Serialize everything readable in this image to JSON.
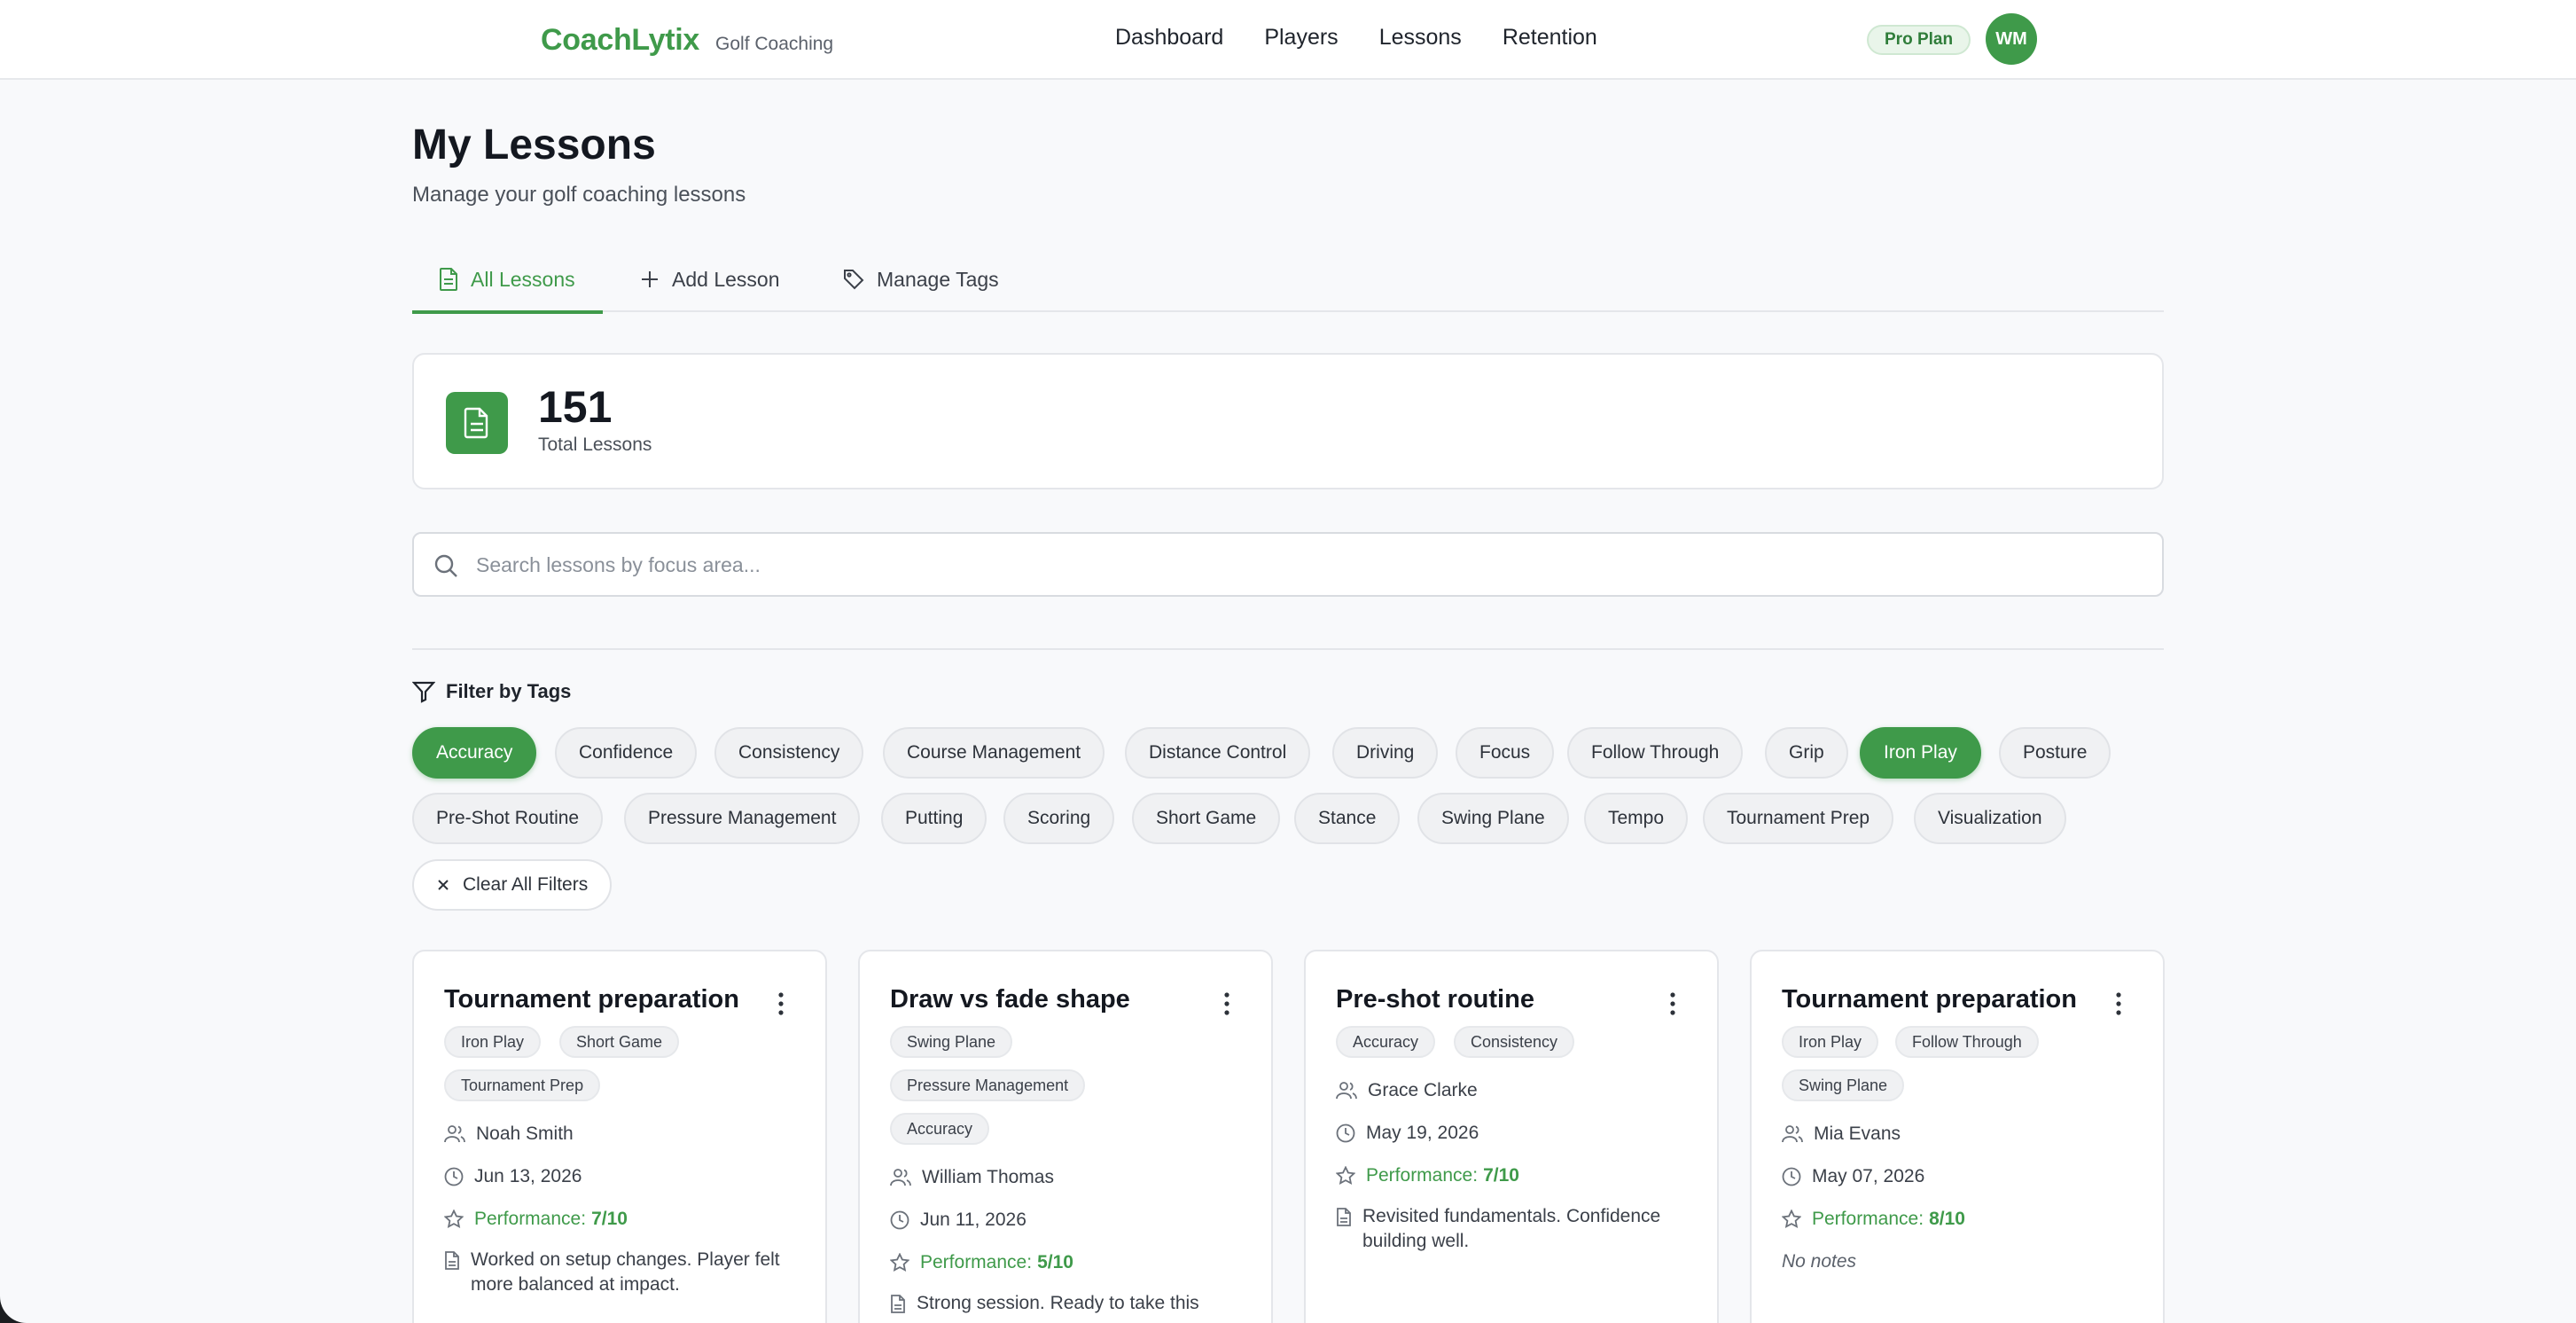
{
  "header": {
    "brand": "CoachLytix",
    "brand_sub": "Golf Coaching",
    "nav": [
      "Dashboard",
      "Players",
      "Lessons",
      "Retention"
    ],
    "plan": "Pro Plan",
    "avatar_initials": "WM"
  },
  "page": {
    "title": "My Lessons",
    "subtitle": "Manage your golf coaching lessons"
  },
  "tabs": [
    {
      "label": "All Lessons",
      "icon": "document-icon",
      "active": true
    },
    {
      "label": "Add Lesson",
      "icon": "plus-icon",
      "active": false
    },
    {
      "label": "Manage Tags",
      "icon": "tag-icon",
      "active": false
    }
  ],
  "stats": {
    "value": "151",
    "label": "Total Lessons"
  },
  "search": {
    "placeholder": "Search lessons by focus area...",
    "value": ""
  },
  "filter": {
    "heading": "Filter by Tags",
    "tags": [
      {
        "label": "Accuracy",
        "active": true
      },
      {
        "label": "Confidence",
        "active": false
      },
      {
        "label": "Consistency",
        "active": false
      },
      {
        "label": "Course Management",
        "active": false
      },
      {
        "label": "Distance Control",
        "active": false
      },
      {
        "label": "Driving",
        "active": false
      },
      {
        "label": "Focus",
        "active": false
      },
      {
        "label": "Follow Through",
        "active": false
      },
      {
        "label": "Grip",
        "active": false
      },
      {
        "label": "Iron Play",
        "active": true
      },
      {
        "label": "Posture",
        "active": false
      },
      {
        "label": "Pre-Shot Routine",
        "active": false
      },
      {
        "label": "Pressure Management",
        "active": false
      },
      {
        "label": "Putting",
        "active": false
      },
      {
        "label": "Scoring",
        "active": false
      },
      {
        "label": "Short Game",
        "active": false
      },
      {
        "label": "Stance",
        "active": false
      },
      {
        "label": "Swing Plane",
        "active": false
      },
      {
        "label": "Tempo",
        "active": false
      },
      {
        "label": "Tournament Prep",
        "active": false
      },
      {
        "label": "Visualization",
        "active": false
      }
    ],
    "clear_label": "Clear All Filters"
  },
  "colors": {
    "accent": "#3f9a4a",
    "background": "#f8f9fb"
  },
  "lessons": [
    {
      "title": "Tournament preparation",
      "tags": [
        "Iron Play",
        "Short Game",
        "Tournament Prep"
      ],
      "player": "Noah Smith",
      "date": "Jun 13, 2026",
      "performance_label": "Performance:",
      "performance": "7/10",
      "notes": "Worked on setup changes. Player felt more balanced at impact."
    },
    {
      "title": "Draw vs fade shape",
      "tags": [
        "Swing Plane",
        "Pressure Management",
        "Accuracy"
      ],
      "player": "William Thomas",
      "date": "Jun 11, 2026",
      "performance_label": "Performance:",
      "performance": "5/10",
      "notes": "Strong session. Ready to take this"
    },
    {
      "title": "Pre-shot routine",
      "tags": [
        "Accuracy",
        "Consistency"
      ],
      "player": "Grace Clarke",
      "date": "May 19, 2026",
      "performance_label": "Performance:",
      "performance": "7/10",
      "notes": "Revisited fundamentals. Confidence building well."
    },
    {
      "title": "Tournament preparation",
      "tags": [
        "Iron Play",
        "Follow Through",
        "Swing Plane"
      ],
      "player": "Mia Evans",
      "date": "May 07, 2026",
      "performance_label": "Performance:",
      "performance": "8/10",
      "notes": "No notes"
    }
  ]
}
